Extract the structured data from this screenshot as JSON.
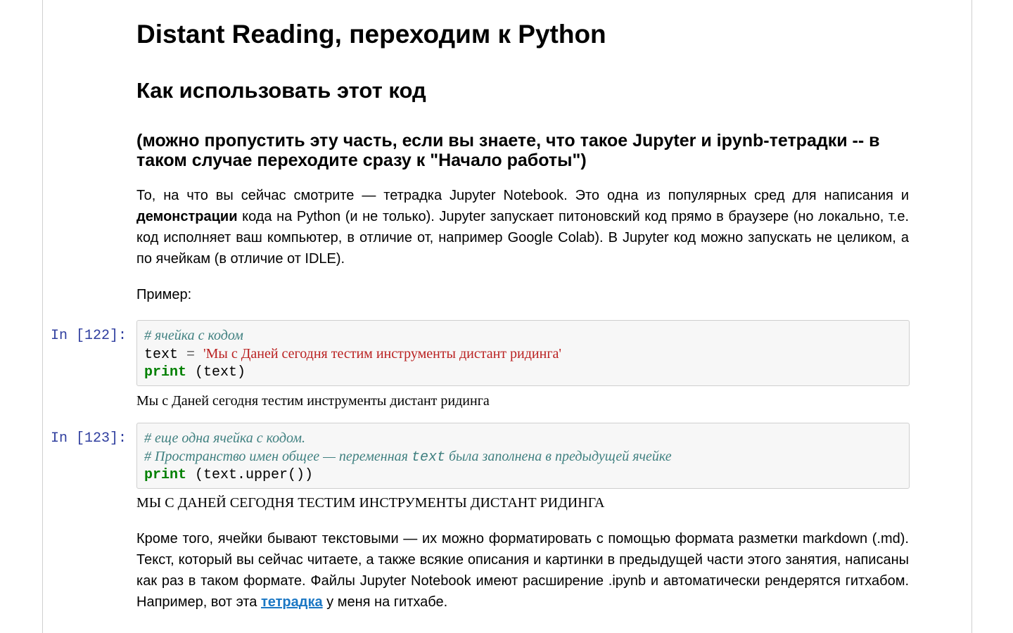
{
  "headings": {
    "h1": "Distant Reading, переходим к Python",
    "h2": "Как использовать этот код",
    "h3": "(можно пропустить эту часть, если вы знаете, что такое Jupyter и ipynb-тетрадки -- в таком случае переходите сразу к \"Начало работы\")"
  },
  "intro": {
    "part1": "То, на что вы сейчас смотрите — тетрадка Jupyter Notebook. Это одна из популярных сред для написания и ",
    "bold": "демонстрации",
    "part2": " кода на Python (и не только). Jupyter запускает питоновский код прямо в браузере (но локально, т.е. код исполняет ваш компьютер, в отличие от, например Google Colab). В Jupyter код можно запускать не целиком, а по ячейкам (в отличие от IDLE)."
  },
  "example_label": "Пример:",
  "cells": [
    {
      "prompt": "In [122]:",
      "comment1": "# ячейка с кодом",
      "var": "text",
      "eq": " = ",
      "string": "'Мы с Даней сегодня тестим инструменты дистант ридинга'",
      "keyword": "print",
      "call": " (text)",
      "output": "Мы с Даней сегодня тестим инструменты дистант ридинга"
    },
    {
      "prompt": "In [123]:",
      "comment1": "# еще одна ячейка с кодом.",
      "comment2_a": "# Пространство имен общее — переменная ",
      "comment2_b": "text",
      "comment2_c": " была заполнена в предыдущей ячейке",
      "keyword": "print",
      "call": " (text.upper())",
      "output": "МЫ С ДАНЕЙ СЕГОДНЯ ТЕСТИМ ИНСТРУМЕНТЫ ДИСТАНТ РИДИНГА"
    }
  ],
  "outro": {
    "part1": "Кроме того, ячейки бывают текстовыми — их можно форматировать с помощью формата разметки markdown (.md). Текст, который вы сейчас читаете, а также всякие описания и картинки в предыдущей части этого занятия, написаны как раз в таком формате. Файлы Jupyter Notebook имеют расширение .ipynb и автоматически рендерятся гитхабом. Например, вот эта ",
    "link": "тетрадка",
    "part2": " у меня на гитхабе."
  },
  "colors": {
    "prompt": "#303f9f",
    "comment": "#408080",
    "keyword": "#008000",
    "string": "#ba2121",
    "link": "#1b77c4"
  }
}
